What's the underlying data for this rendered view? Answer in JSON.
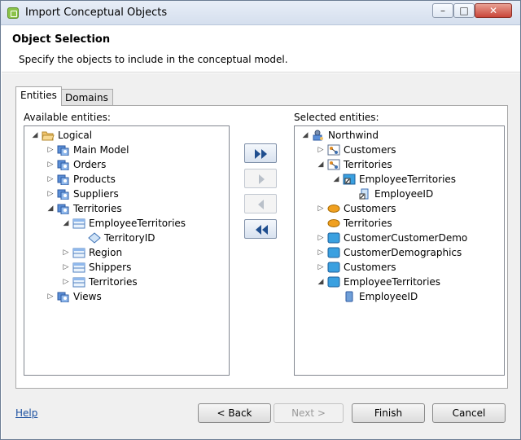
{
  "window": {
    "title": "Import Conceptual Objects"
  },
  "header": {
    "title": "Object Selection",
    "description": "Specify the objects to include in the conceptual model."
  },
  "tabs": [
    {
      "label": "Entities",
      "active": true
    },
    {
      "label": "Domains",
      "active": false
    }
  ],
  "available": {
    "label": "Available entities:",
    "items": [
      {
        "label": "Logical",
        "expander": "◢",
        "icon": "folder-open-icon",
        "depth": 0
      },
      {
        "label": "Main Model",
        "expander": "▷",
        "icon": "model-icon",
        "depth": 1
      },
      {
        "label": "Orders",
        "expander": "▷",
        "icon": "model-icon",
        "depth": 1
      },
      {
        "label": "Products",
        "expander": "▷",
        "icon": "model-icon",
        "depth": 1
      },
      {
        "label": "Suppliers",
        "expander": "▷",
        "icon": "model-icon",
        "depth": 1
      },
      {
        "label": "Territories",
        "expander": "◢",
        "icon": "model-icon",
        "depth": 1
      },
      {
        "label": "EmployeeTerritories",
        "expander": "◢",
        "icon": "table-icon",
        "depth": 2
      },
      {
        "label": "TerritoryID",
        "expander": "",
        "icon": "attribute-diamond-icon",
        "depth": 3
      },
      {
        "label": "Region",
        "expander": "▷",
        "icon": "table-icon",
        "depth": 2
      },
      {
        "label": "Shippers",
        "expander": "▷",
        "icon": "table-icon",
        "depth": 2
      },
      {
        "label": "Territories",
        "expander": "▷",
        "icon": "table-icon",
        "depth": 2
      },
      {
        "label": "Views",
        "expander": "▷",
        "icon": "model-icon",
        "depth": 1
      }
    ]
  },
  "selected": {
    "label": "Selected entities:",
    "items": [
      {
        "label": "Northwind",
        "expander": "◢",
        "icon": "person-model-icon",
        "depth": 0
      },
      {
        "label": "Customers",
        "expander": "▷",
        "icon": "relationship-icon",
        "depth": 1
      },
      {
        "label": "Territories",
        "expander": "◢",
        "icon": "relationship-icon",
        "depth": 1
      },
      {
        "label": "EmployeeTerritories",
        "expander": "◢",
        "icon": "entity-shortcut-icon",
        "depth": 2
      },
      {
        "label": "EmployeeID",
        "expander": "",
        "icon": "attribute-shortcut-icon",
        "depth": 3
      },
      {
        "label": "Customers",
        "expander": "▷",
        "icon": "ellipse-icon",
        "depth": 1
      },
      {
        "label": "Territories",
        "expander": "",
        "icon": "ellipse-icon",
        "depth": 1
      },
      {
        "label": "CustomerCustomerDemo",
        "expander": "▷",
        "icon": "entity-icon",
        "depth": 1
      },
      {
        "label": "CustomerDemographics",
        "expander": "▷",
        "icon": "entity-icon",
        "depth": 1
      },
      {
        "label": "Customers",
        "expander": "▷",
        "icon": "entity-icon",
        "depth": 1
      },
      {
        "label": "EmployeeTerritories",
        "expander": "◢",
        "icon": "entity-icon",
        "depth": 1
      },
      {
        "label": "EmployeeID",
        "expander": "",
        "icon": "attribute-icon",
        "depth": 2
      }
    ]
  },
  "transfer": {
    "add_all": "▶▶",
    "add": "▶",
    "remove": "◀",
    "remove_all": "◀◀"
  },
  "footer": {
    "help": "Help",
    "back": "< Back",
    "next": "Next >",
    "finish": "Finish",
    "cancel": "Cancel"
  },
  "colors": {
    "accent": "#1a4fa0",
    "folder": "#f0c36b",
    "ellipse": "#f0a020",
    "entity": "#3aa0e0"
  }
}
